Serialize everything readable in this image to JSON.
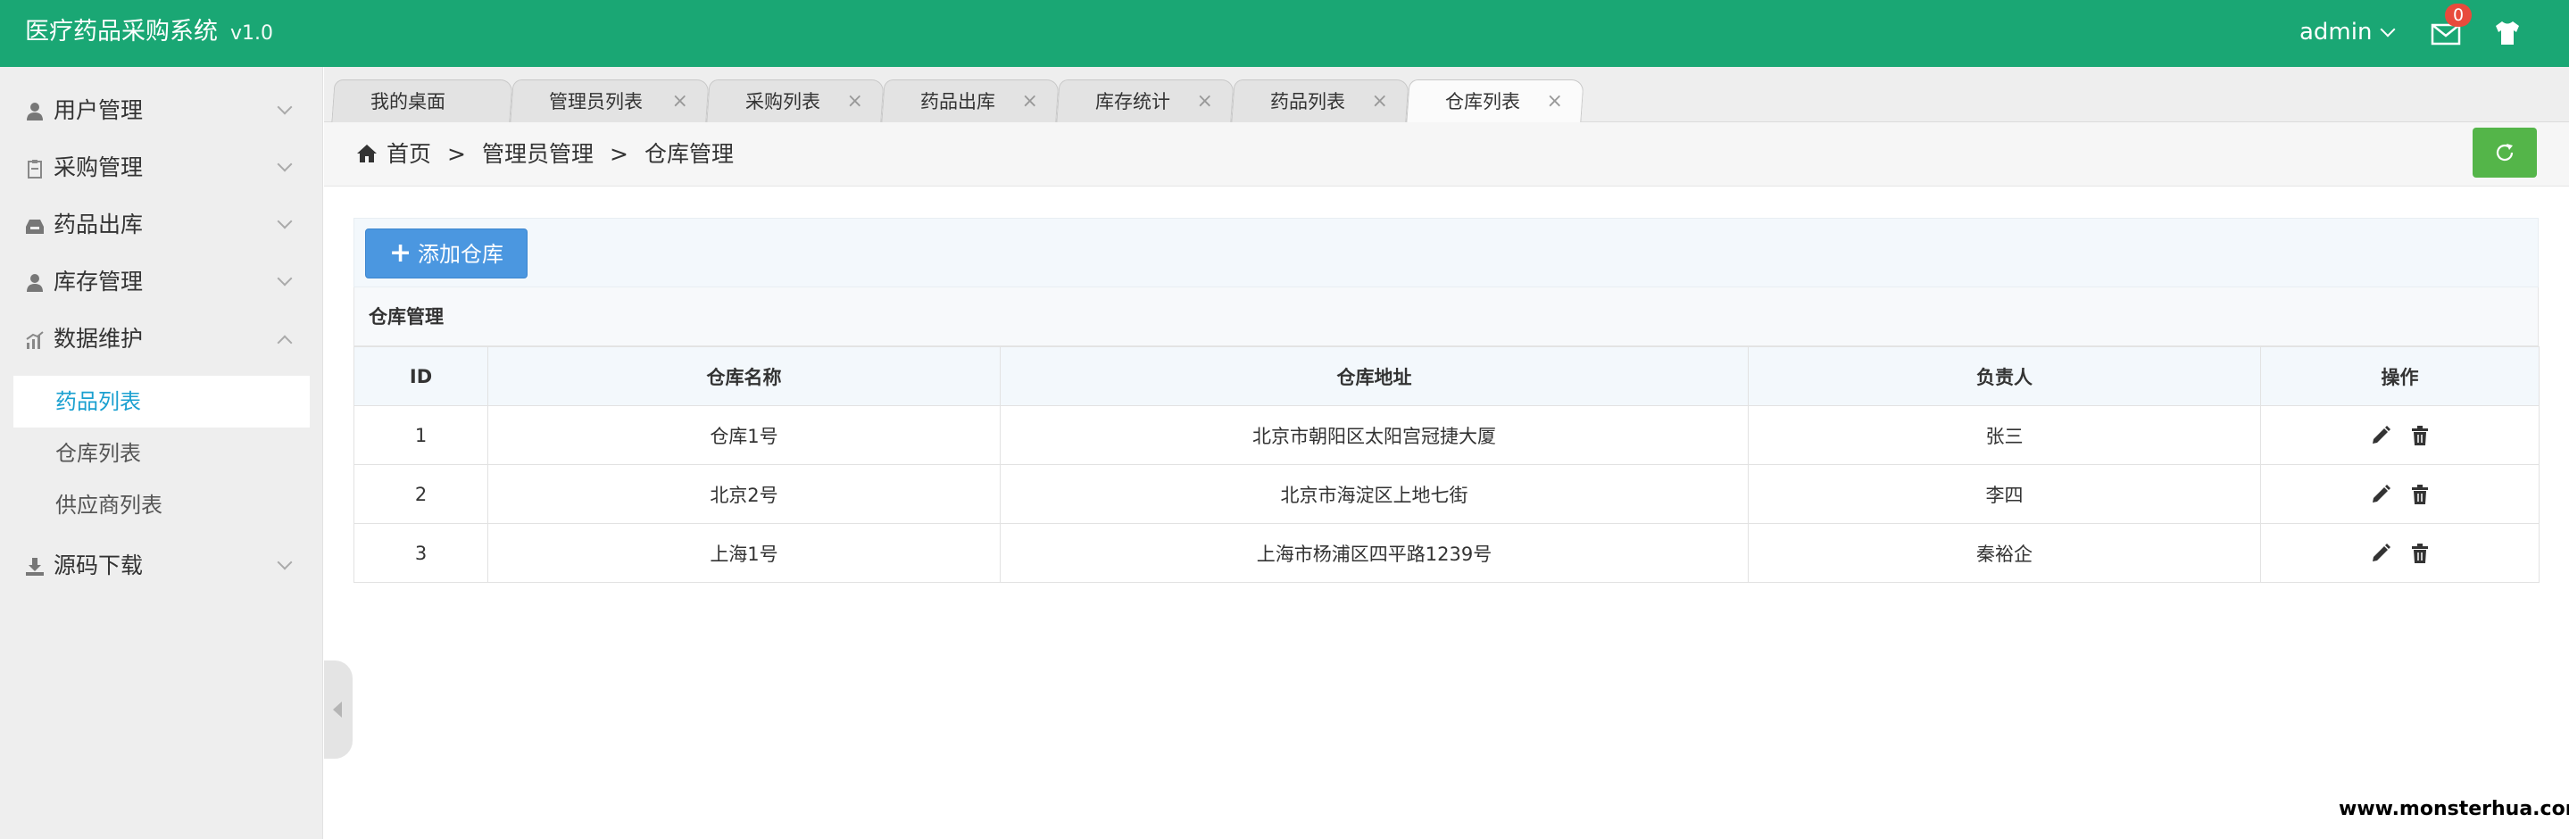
{
  "header": {
    "title": "医疗药品采购系统",
    "version": "v1.0",
    "user": "admin",
    "mail_count": "0"
  },
  "sidebar": {
    "items": [
      {
        "label": "用户管理",
        "icon": "user-icon"
      },
      {
        "label": "采购管理",
        "icon": "clipboard-icon"
      },
      {
        "label": "药品出库",
        "icon": "inbox-icon"
      },
      {
        "label": "库存管理",
        "icon": "user-icon"
      },
      {
        "label": "数据维护",
        "icon": "chart-icon",
        "expanded": true
      },
      {
        "label": "源码下载",
        "icon": "download-icon"
      }
    ],
    "sub_items": [
      {
        "label": "药品列表",
        "active": true
      },
      {
        "label": "仓库列表"
      },
      {
        "label": "供应商列表"
      }
    ]
  },
  "tabs": [
    {
      "label": "我的桌面"
    },
    {
      "label": "管理员列表"
    },
    {
      "label": "采购列表"
    },
    {
      "label": "药品出库"
    },
    {
      "label": "库存统计"
    },
    {
      "label": "药品列表"
    },
    {
      "label": "仓库列表",
      "active": true
    }
  ],
  "tab_close": "×",
  "breadcrumb": {
    "items": [
      "首页",
      "管理员管理",
      "仓库管理"
    ],
    "separator": ">"
  },
  "toolbar": {
    "add_label": "添加仓库"
  },
  "panel": {
    "title": "仓库管理"
  },
  "table": {
    "columns": [
      "ID",
      "仓库名称",
      "仓库地址",
      "负责人",
      "操作"
    ],
    "rows": [
      [
        "1",
        "仓库1号",
        "北京市朝阳区太阳宫冠捷大厦",
        "张三"
      ],
      [
        "2",
        "北京2号",
        "北京市海淀区上地七街",
        "李四"
      ],
      [
        "3",
        "上海1号",
        "上海市杨浦区四平路1239号",
        "秦裕企"
      ]
    ]
  },
  "watermark": "www.monsterhua.com",
  "colors": {
    "header": "#1aa774",
    "primary_button": "#4b97e0",
    "refresh_button": "#54b549",
    "active_link": "#1aa0d0",
    "badge": "#e84b3c"
  }
}
